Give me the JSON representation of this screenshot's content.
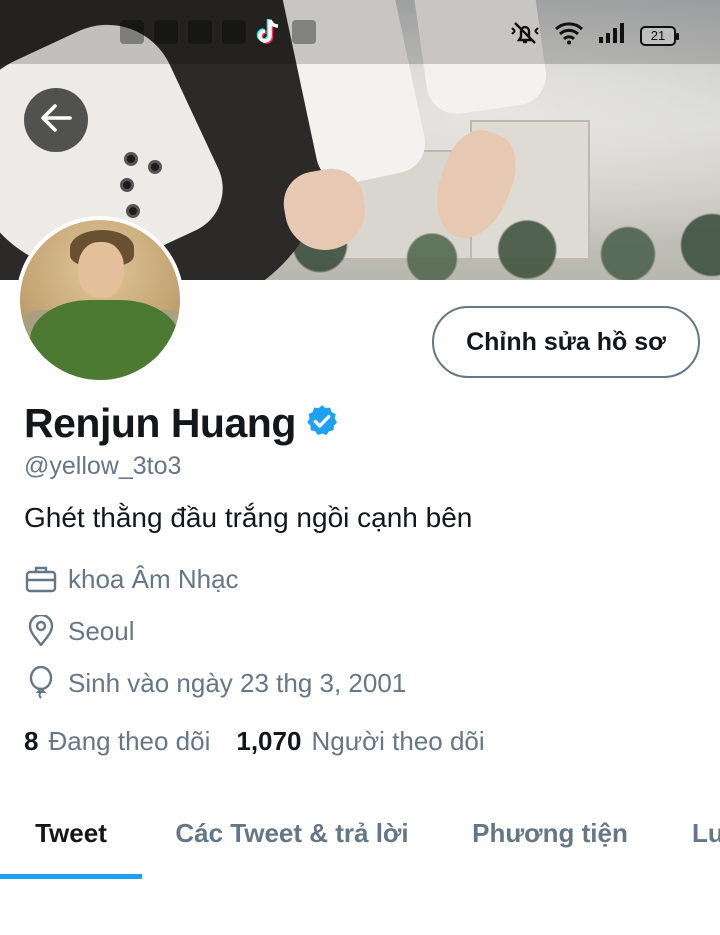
{
  "status_bar": {
    "battery": "21"
  },
  "profile": {
    "name": "Renjun Huang",
    "handle": "@yellow_3to3",
    "bio": "Ghét thằng đầu trắng ngồi cạnh bên",
    "work": "khoa Âm Nhạc",
    "location": "Seoul",
    "birthday": "Sinh vào ngày 23 thg 3, 2001",
    "following_count": "8",
    "following_label": "Đang theo dõi",
    "followers_count": "1,070",
    "followers_label": "Người theo dõi"
  },
  "actions": {
    "edit_profile_label": "Chỉnh sửa hồ sơ"
  },
  "tabs": [
    {
      "label": "Tweet",
      "active": true
    },
    {
      "label": "Các Tweet & trả lời",
      "active": false
    },
    {
      "label": "Phương tiện",
      "active": false
    },
    {
      "label": "Lu",
      "active": false
    }
  ],
  "colors": {
    "accent": "#1da1f2",
    "text_primary": "#14171a",
    "text_secondary": "#657786",
    "verified": "#1da1f2"
  },
  "icons": {
    "back": "arrow-left-icon",
    "verified": "verified-badge-icon",
    "work": "briefcase-icon",
    "location": "location-pin-icon",
    "birthday": "balloon-icon"
  }
}
